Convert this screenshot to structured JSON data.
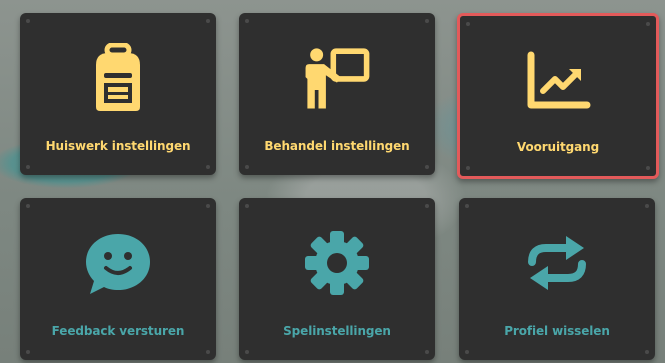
{
  "menu": {
    "tiles": [
      {
        "label": "Huiswerk instellingen",
        "icon": "backpack-icon",
        "color": "#ffd870",
        "selected": false
      },
      {
        "label": "Behandel instellingen",
        "icon": "teacher-board-icon",
        "color": "#ffd870",
        "selected": false
      },
      {
        "label": "Vooruitgang",
        "icon": "progress-chart-icon",
        "color": "#ffd870",
        "selected": true
      },
      {
        "label": "Feedback versturen",
        "icon": "smiley-chat-icon",
        "color": "#4aa6a9",
        "selected": false
      },
      {
        "label": "Spelinstellingen",
        "icon": "gear-icon",
        "color": "#4aa6a9",
        "selected": false
      },
      {
        "label": "Profiel wisselen",
        "icon": "swap-arrows-icon",
        "color": "#4aa6a9",
        "selected": false
      }
    ]
  },
  "colors": {
    "tile_bg": "#2f2f2f",
    "selected_border": "#e35a5a",
    "yellow_accent": "#ffd870",
    "teal_accent": "#4aa6a9"
  }
}
